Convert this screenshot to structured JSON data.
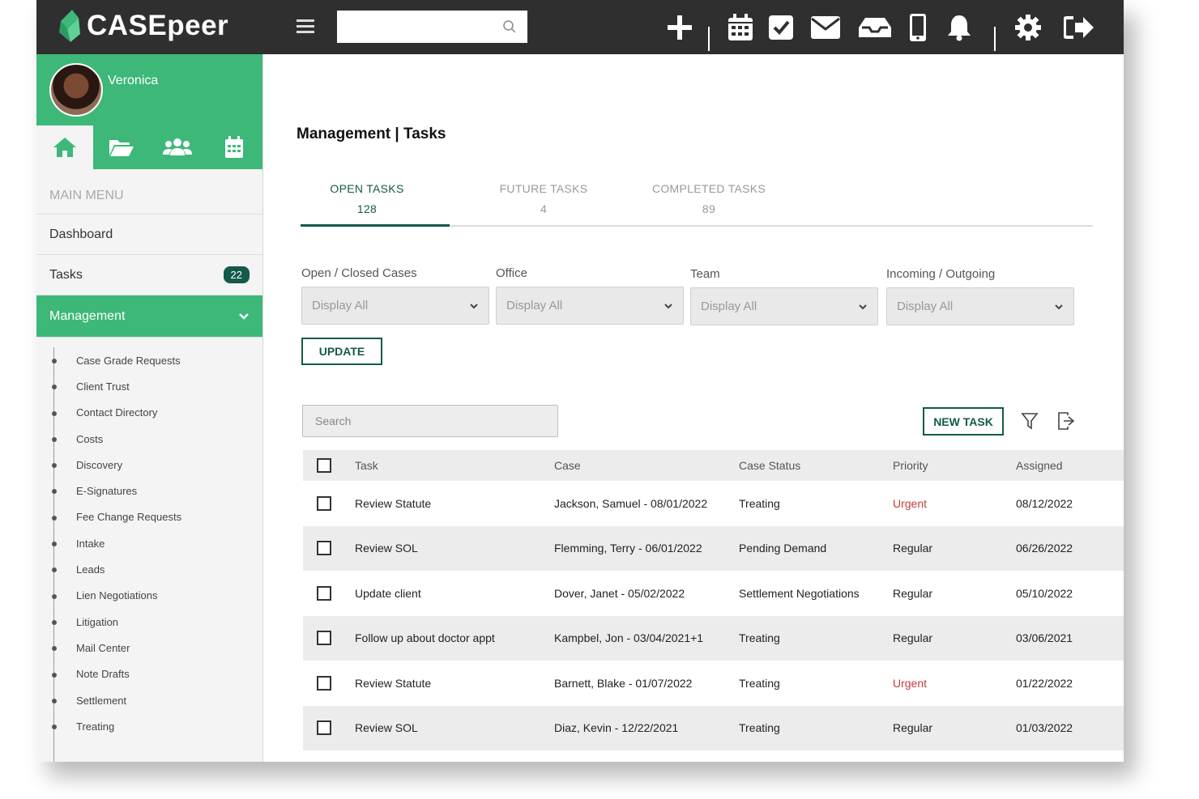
{
  "app": {
    "name": "CASEpeer"
  },
  "topbar": {
    "search_placeholder": "",
    "icons": [
      "add-icon",
      "calendar-icon",
      "tasks-check-icon",
      "mail-icon",
      "inbox-icon",
      "mobile-icon",
      "bell-icon",
      "gear-icon",
      "logout-icon"
    ]
  },
  "user": {
    "name": "Veronica"
  },
  "sidebar": {
    "quick_nav": [
      "home-icon",
      "folder-icon",
      "users-icon",
      "calendar-icon"
    ],
    "menu_header": "MAIN MENU",
    "items": [
      {
        "label": "Dashboard"
      },
      {
        "label": "Tasks",
        "badge": "22"
      },
      {
        "label": "Management"
      }
    ],
    "submenu": [
      "Case Grade Requests",
      "Client Trust",
      "Contact Directory",
      "Costs",
      "Discovery",
      "E-Signatures",
      "Fee Change Requests",
      "Intake",
      "Leads",
      "Lien Negotiations",
      "Litigation",
      "Mail Center",
      "Note Drafts",
      "Settlement",
      "Treating"
    ]
  },
  "page": {
    "title": "Management | Tasks",
    "tabs": [
      {
        "label": "OPEN TASKS",
        "count": "128"
      },
      {
        "label": "FUTURE TASKS",
        "count": "4"
      },
      {
        "label": "COMPLETED TASKS",
        "count": "89"
      }
    ],
    "filters": [
      {
        "label": "Open / Closed Cases",
        "value": "Display All"
      },
      {
        "label": "Office",
        "value": "Display All"
      },
      {
        "label": "Team",
        "value": "Display All"
      },
      {
        "label": "Incoming / Outgoing",
        "value": "Display All"
      }
    ],
    "update_label": "UPDATE",
    "search_placeholder": "Search",
    "new_task_label": "NEW TASK"
  },
  "colors": {
    "brand_green": "#3db878",
    "dark_teal": "#145a4a",
    "urgent": "#c23b3b",
    "topbar": "#2f2f2f"
  },
  "table": {
    "columns": [
      "Task",
      "Case",
      "Case Status",
      "Priority",
      "Assigned"
    ],
    "rows": [
      {
        "task": "Review Statute",
        "case": "Jackson, Samuel - 08/01/2022",
        "status": "Treating",
        "priority": "Urgent",
        "assigned": "08/12/2022"
      },
      {
        "task": "Review SOL",
        "case": "Flemming, Terry - 06/01/2022",
        "status": "Pending Demand",
        "priority": "Regular",
        "assigned": "06/26/2022"
      },
      {
        "task": "Update client",
        "case": "Dover, Janet - 05/02/2022",
        "status": "Settlement Negotiations",
        "priority": "Regular",
        "assigned": "05/10/2022"
      },
      {
        "task": "Follow up about doctor appt",
        "case": "Kampbel, Jon - 03/04/2021+1",
        "status": "Treating",
        "priority": "Regular",
        "assigned": "03/06/2021"
      },
      {
        "task": "Review Statute",
        "case": "Barnett, Blake - 01/07/2022",
        "status": "Treating",
        "priority": "Urgent",
        "assigned": "01/22/2022"
      },
      {
        "task": "Review SOL",
        "case": "Diaz, Kevin - 12/22/2021",
        "status": "Treating",
        "priority": "Regular",
        "assigned": "01/03/2022"
      }
    ]
  }
}
